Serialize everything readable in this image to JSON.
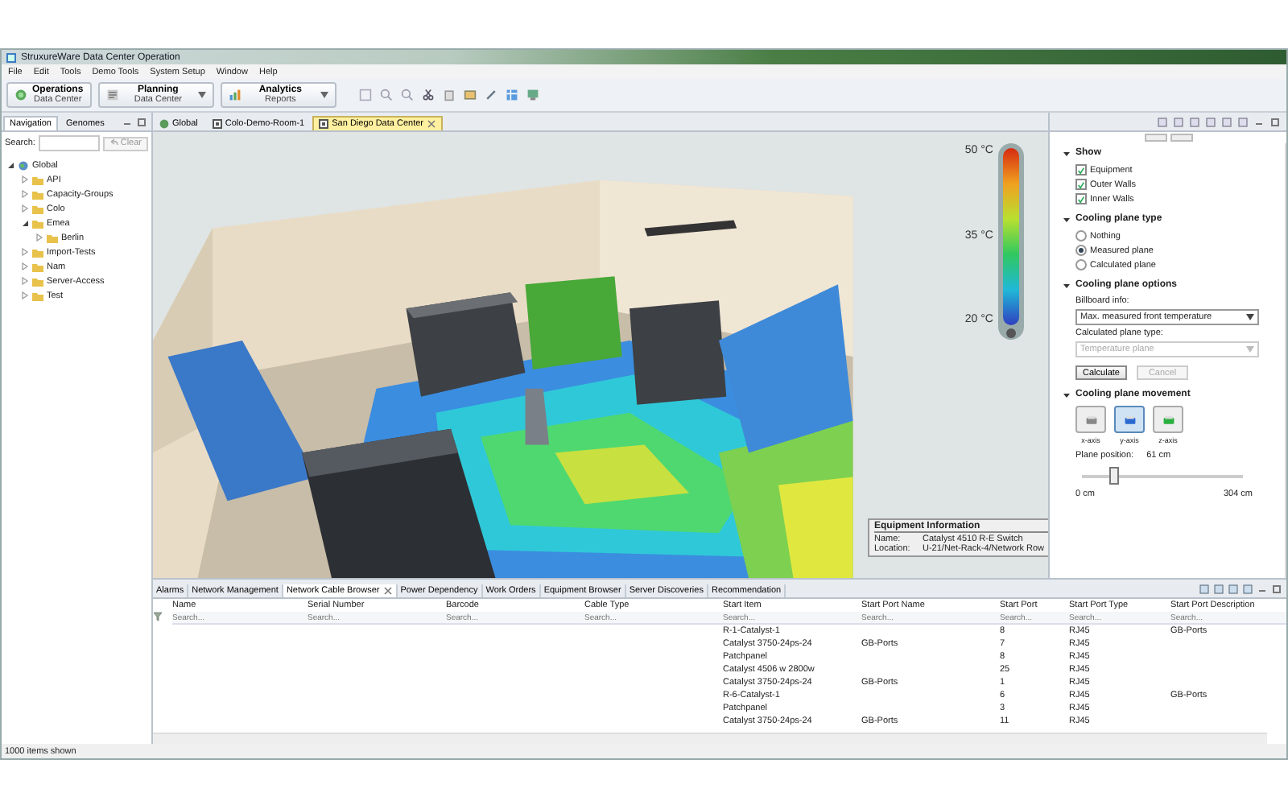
{
  "window": {
    "title": "StruxureWare Data Center Operation"
  },
  "menu": [
    "File",
    "Edit",
    "Tools",
    "Demo Tools",
    "System Setup",
    "Window",
    "Help"
  ],
  "perspectives": [
    {
      "title": "Operations",
      "subtitle": "Data Center",
      "dropdown": false
    },
    {
      "title": "Planning",
      "subtitle": "Data Center",
      "dropdown": true
    },
    {
      "title": "Analytics",
      "subtitle": "Reports",
      "dropdown": true
    }
  ],
  "navigator": {
    "tabs": [
      {
        "label": "Navigation",
        "selected": true
      },
      {
        "label": "Genomes",
        "selected": false
      }
    ],
    "search_label": "Search:",
    "clear_button": "Clear",
    "tree": [
      {
        "label": "Global",
        "expanded": true,
        "children": [
          {
            "label": "API",
            "expanded": false
          },
          {
            "label": "Capacity-Groups",
            "expanded": false
          },
          {
            "label": "Colo",
            "expanded": false
          },
          {
            "label": "Emea",
            "expanded": true,
            "children": [
              {
                "label": "Berlin",
                "expanded": false
              }
            ]
          },
          {
            "label": "Import-Tests",
            "expanded": false
          },
          {
            "label": "Nam",
            "expanded": false
          },
          {
            "label": "Server-Access",
            "expanded": false
          },
          {
            "label": "Test",
            "expanded": false
          }
        ]
      }
    ]
  },
  "editor_tabs": [
    {
      "label": "Global",
      "selected": false
    },
    {
      "label": "Colo-Demo-Room-1",
      "selected": false
    },
    {
      "label": "San Diego Data Center",
      "selected": true
    }
  ],
  "temperature_scale": {
    "labels": [
      "50 °C",
      "35 °C",
      "20 °C"
    ]
  },
  "equipment_info": {
    "title": "Equipment Information",
    "fields": [
      {
        "label": "Name:",
        "value": "Catalyst 4510 R-E Switch"
      },
      {
        "label": "Location:",
        "value": "U-21/Net-Rack-4/Network Row"
      }
    ]
  },
  "show": {
    "title": "Show",
    "expanded": true,
    "checkboxes": [
      {
        "label": "Equipment",
        "checked": true
      },
      {
        "label": "Outer Walls",
        "checked": true
      },
      {
        "label": "Inner Walls",
        "checked": true
      }
    ]
  },
  "cooling_plane_type": {
    "title": "Cooling plane type",
    "expanded": true,
    "options": [
      {
        "label": "Nothing",
        "selected": false
      },
      {
        "label": "Measured plane",
        "selected": true
      },
      {
        "label": "Calculated plane",
        "selected": false
      }
    ]
  },
  "cooling_plane_options": {
    "title": "Cooling plane options",
    "expanded": true,
    "billboard_label": "Billboard info:",
    "billboard_value": "Max. measured front temperature",
    "plane_type_label": "Calculated plane type:",
    "plane_type_value": "Temperature plane",
    "plane_type_disabled": true,
    "buttons": [
      {
        "label": "Calculate",
        "disabled": false
      },
      {
        "label": "Cancel",
        "disabled": true
      }
    ]
  },
  "cooling_plane_movement": {
    "title": "Cooling plane movement",
    "expanded": true,
    "axes": [
      {
        "label": "x-axis",
        "selected": false
      },
      {
        "label": "y-axis",
        "selected": true
      },
      {
        "label": "z-axis",
        "selected": false
      }
    ],
    "position_label": "Plane position:",
    "position_value": "61 cm",
    "level": 0.2,
    "min_label": "0 cm",
    "max_label": "304 cm"
  },
  "bottom_tabs": [
    {
      "label": "Alarms",
      "selected": false
    },
    {
      "label": "Network Management",
      "selected": false
    },
    {
      "label": "Network Cable Browser",
      "selected": true
    },
    {
      "label": "Power Dependency",
      "selected": false
    },
    {
      "label": "Work Orders",
      "selected": false
    },
    {
      "label": "Equipment Browser",
      "selected": false
    },
    {
      "label": "Server Discoveries",
      "selected": false
    },
    {
      "label": "Recommendation",
      "selected": false
    }
  ],
  "cable_table": {
    "columns": [
      {
        "label": "Name",
        "placeholder": "Search..."
      },
      {
        "label": "Serial Number",
        "placeholder": "Search..."
      },
      {
        "label": "Barcode",
        "placeholder": "Search..."
      },
      {
        "label": "Cable Type",
        "placeholder": "Search..."
      },
      {
        "label": "Start Item",
        "placeholder": "Search..."
      },
      {
        "label": "Start Port Name",
        "placeholder": "Search..."
      },
      {
        "label": "Start Port",
        "placeholder": "Search..."
      },
      {
        "label": "Start Port Type",
        "placeholder": "Search..."
      },
      {
        "label": "Start Port Description",
        "placeholder": "Search..."
      }
    ],
    "rows": [
      {
        "start_item": "R-1-Catalyst-1",
        "start_port": "8",
        "start_port_type": "RJ45",
        "start_port_description": "GB-Ports"
      },
      {
        "start_item": "Catalyst 3750-24ps-24",
        "start_port_name": "GB-Ports",
        "start_port": "7",
        "start_port_type": "RJ45"
      },
      {
        "start_item": "Patchpanel",
        "start_port": "8",
        "start_port_type": "RJ45"
      },
      {
        "start_item": "Catalyst 4506 w 2800w",
        "start_port": "25",
        "start_port_type": "RJ45"
      },
      {
        "start_item": "Catalyst 3750-24ps-24",
        "start_port_name": "GB-Ports",
        "start_port": "1",
        "start_port_type": "RJ45"
      },
      {
        "start_item": "R-6-Catalyst-1",
        "start_port": "6",
        "start_port_type": "RJ45",
        "start_port_description": "GB-Ports"
      },
      {
        "start_item": "Patchpanel",
        "start_port": "3",
        "start_port_type": "RJ45"
      },
      {
        "start_item": "Catalyst 3750-24ps-24",
        "start_port_name": "GB-Ports",
        "start_port": "11",
        "start_port_type": "RJ45"
      }
    ]
  },
  "status": "1000 items shown"
}
